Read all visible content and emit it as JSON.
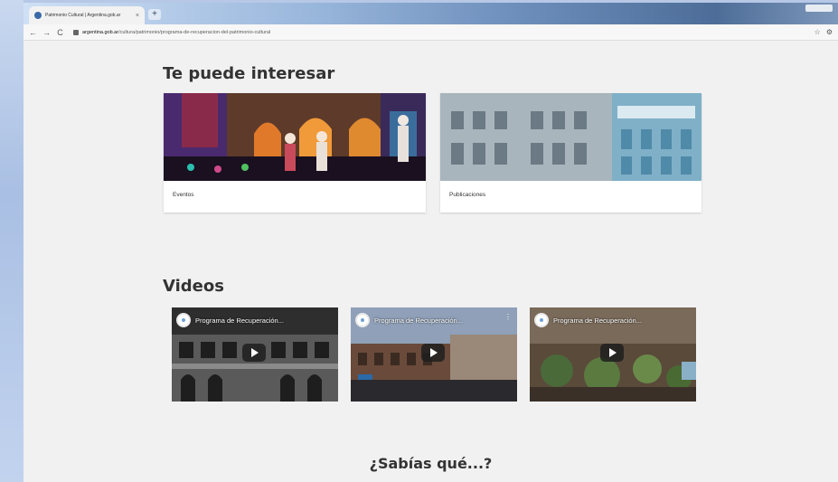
{
  "browser": {
    "tab_title": "Patrimonio Cultural | Argentina.gob.ar",
    "tab_close": "×",
    "new_tab": "+",
    "nav_back": "←",
    "nav_forward": "→",
    "nav_reload": "C",
    "url_domain": "argentina.gob.ar",
    "url_path": "/cultura/patrimonio/programa-de-recuperacion-del-patrimonio-cultural",
    "star": "☆",
    "account": "⚙"
  },
  "interest": {
    "title": "Te puede interesar",
    "cards": [
      {
        "label": "Eventos"
      },
      {
        "label": "Publicaciones"
      }
    ]
  },
  "videos": {
    "title": "Videos",
    "items": [
      {
        "title": "Programa de Recuperación..."
      },
      {
        "title": "Programa de Recuperación..."
      },
      {
        "title": "Programa de Recuperación..."
      }
    ],
    "more": "⋮"
  },
  "sabias": {
    "title": "¿Sabías qué...?"
  }
}
